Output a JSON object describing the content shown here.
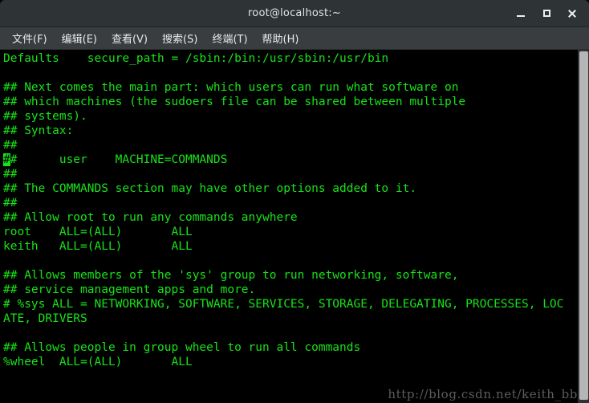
{
  "window": {
    "title": "root@localhost:~",
    "controls": [
      {
        "name": "minimize",
        "label": "_"
      },
      {
        "name": "maximize",
        "label": "□"
      },
      {
        "name": "close",
        "label": "✕"
      }
    ]
  },
  "menubar": {
    "items": [
      {
        "label": "文件(F)"
      },
      {
        "label": "编辑(E)"
      },
      {
        "label": "查看(V)"
      },
      {
        "label": "搜索(S)"
      },
      {
        "label": "终端(T)"
      },
      {
        "label": "帮助(H)"
      }
    ]
  },
  "terminal": {
    "foreground": "#18e318",
    "background": "#000000",
    "cursor": {
      "row": 7,
      "col": 0,
      "char": "#"
    },
    "lines": [
      "Defaults    secure_path = /sbin:/bin:/usr/sbin:/usr/bin",
      "",
      "## Next comes the main part: which users can run what software on",
      "## which machines (the sudoers file can be shared between multiple",
      "## systems).",
      "## Syntax:",
      "##",
      "##      user    MACHINE=COMMANDS",
      "##",
      "## The COMMANDS section may have other options added to it.",
      "##",
      "## Allow root to run any commands anywhere",
      "root    ALL=(ALL)       ALL",
      "keith   ALL=(ALL)       ALL",
      "",
      "## Allows members of the 'sys' group to run networking, software,",
      "## service management apps and more.",
      "# %sys ALL = NETWORKING, SOFTWARE, SERVICES, STORAGE, DELEGATING, PROCESSES, LOC",
      "ATE, DRIVERS",
      "",
      "## Allows people in group wheel to run all commands",
      "%wheel  ALL=(ALL)       ALL"
    ]
  },
  "scrollbar": {
    "orientation": "vertical",
    "thumb_color": "#b6b6b6",
    "track_color": "#2e3436"
  },
  "watermark": {
    "text": "http://blog.csdn.net/keith_bb"
  }
}
